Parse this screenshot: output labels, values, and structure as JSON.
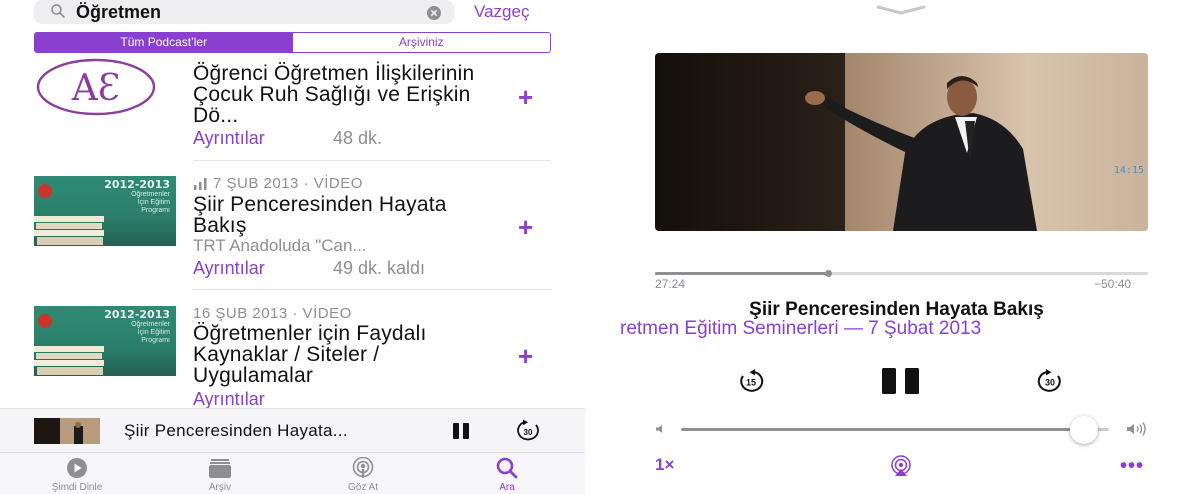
{
  "search": {
    "query": "Öğretmen",
    "cancel_label": "Vazgeç",
    "scopes": [
      "Tüm Podcast’ler",
      "Arşiviniz"
    ]
  },
  "episodes": [
    {
      "date": "",
      "title": "Öğrenci Öğretmen İlişkilerinin Çocuk Ruh Sağlığı ve Erişkin Dö...",
      "subtitle": "",
      "details_label": "Ayrıntılar",
      "duration": "48 dk."
    },
    {
      "date": "7 ŞUB 2013 · VİDEO",
      "title": "Şiir Penceresinden Hayata Bakış",
      "subtitle": "TRT Anadoluda \"Can...",
      "details_label": "Ayrıntılar",
      "duration": "49 dk. kaldı"
    },
    {
      "date": "16 ŞUB 2013 · VİDEO",
      "title": "Öğretmenler için Faydalı Kaynaklar / Siteler / Uygulamalar",
      "subtitle": "",
      "details_label": "Ayrıntılar",
      "duration": ""
    }
  ],
  "thumb": {
    "logo_text": "AƐ",
    "years": "2012-2013",
    "caption_lines": [
      "Öğretmenler",
      "İçin Eğitim",
      "Programı"
    ]
  },
  "mini_player": {
    "title": "Şiir Penceresinden Hayata...",
    "skip_label": "30"
  },
  "tabs": [
    {
      "label": "Şimdi Dinle",
      "icon": "play-circle-icon",
      "active": false
    },
    {
      "label": "Arşiv",
      "icon": "library-icon",
      "active": false
    },
    {
      "label": "Göz At",
      "icon": "podcast-icon",
      "active": false
    },
    {
      "label": "Ara",
      "icon": "search-icon",
      "active": true
    }
  ],
  "now_playing": {
    "video_clock": "14:15",
    "elapsed": "27:24",
    "remaining": "−50:40",
    "progress": 0.35,
    "title": "Şiir Penceresinden Hayata Bakış",
    "subtitle": "retmen Eğitim Seminerleri — 7 Şubat 2013",
    "skip_back": "15",
    "skip_forward": "30",
    "volume": 0.91,
    "speed": "1×"
  },
  "colors": {
    "accent": "#8a3fd0",
    "secondary_text": "#8e8e93"
  }
}
